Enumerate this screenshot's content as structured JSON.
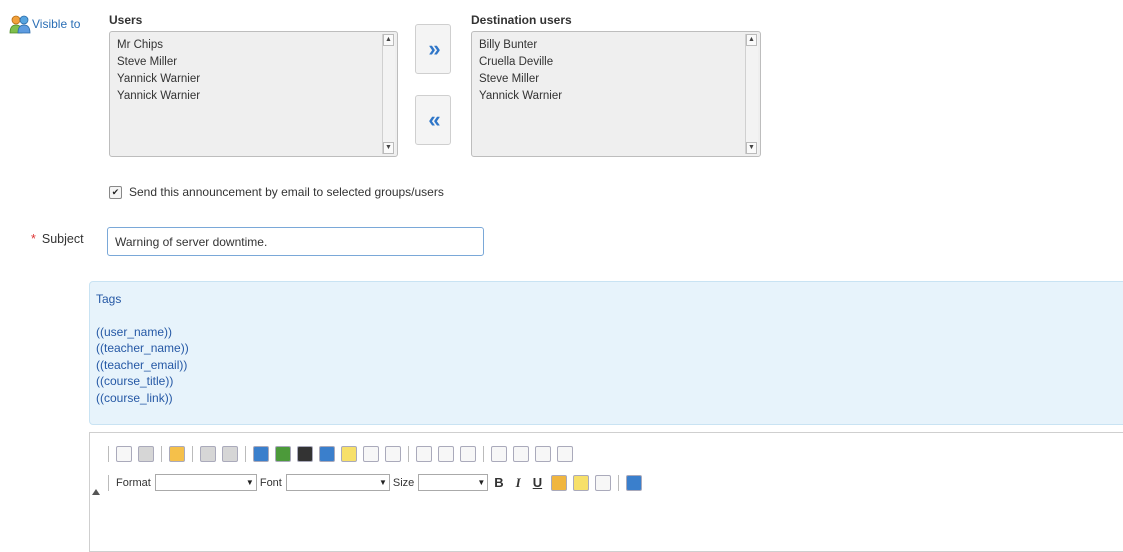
{
  "visible_to": {
    "label": "Visible to"
  },
  "users": {
    "title": "Users",
    "items": [
      "Mr Chips",
      "Steve Miller",
      "Yannick Warnier",
      "Yannick Warnier"
    ]
  },
  "destination": {
    "title": "Destination users",
    "items": [
      "Billy Bunter",
      "Cruella Deville",
      "Steve Miller",
      "Yannick Warnier"
    ]
  },
  "move_buttons": {
    "add": "»",
    "remove": "«"
  },
  "email_option": {
    "label": "Send this announcement by email to selected groups/users",
    "checked": true
  },
  "subject": {
    "required_mark": "*",
    "label": "Subject",
    "value": "Warning of server downtime."
  },
  "tags": {
    "title": "Tags",
    "items": [
      "((user_name))",
      "((teacher_name))",
      "((teacher_email))",
      "((course_title))",
      "((course_link))"
    ]
  },
  "editor": {
    "format_label": "Format",
    "font_label": "Font",
    "size_label": "Size",
    "bold_label": "B",
    "italic_label": "I",
    "underline_label": "U",
    "toolbar_icons_row1": [
      "new-page-icon",
      "templates-icon",
      "paste-word-icon",
      "undo-icon",
      "redo-icon",
      "image-icon",
      "flash-icon",
      "video-icon",
      "link-icon",
      "audio-icon",
      "table-icon",
      "formula-icon",
      "bullet-list-icon",
      "numbered-list-icon",
      "horizontal-rule-icon",
      "align-left-icon",
      "align-center-icon",
      "align-right-icon",
      "justify-icon"
    ],
    "toolbar_icons_row2": [
      "text-color-icon",
      "background-color-icon",
      "source-icon",
      "maximize-icon"
    ]
  },
  "colors": {
    "link_blue": "#2a6eb5",
    "tag_bg": "#e7f3fb",
    "tag_text": "#2558a5",
    "required": "#d33333",
    "move_arrow": "#2f76c8"
  }
}
